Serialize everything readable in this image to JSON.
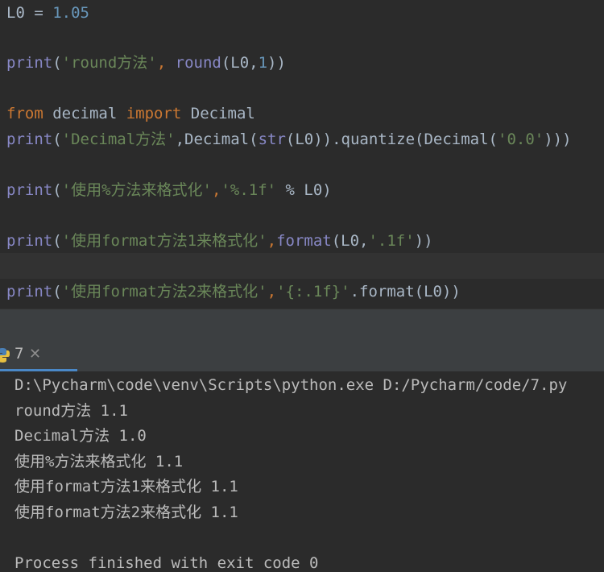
{
  "editor": {
    "line1": {
      "var": "L0",
      "eq": " = ",
      "num": "1.05"
    },
    "line2": {
      "fn": "print",
      "open": "(",
      "str": "'round方法'",
      "comma": ", ",
      "fn2": "round",
      "args_open": "(L0,",
      "num": "1",
      "close": "))"
    },
    "line3": {
      "kw1": "from",
      "mod": " decimal ",
      "kw2": "import",
      "name": " Decimal"
    },
    "line4": {
      "fn": "print",
      "open": "(",
      "str": "'Decimal方法'",
      "mid1": ",Decimal(",
      "fn2": "str",
      "mid2": "(L0)).quantize(Decimal(",
      "str2": "'0.0'",
      "close": ")))"
    },
    "line5": {
      "fn": "print",
      "open": "(",
      "str": "'使用%方法来格式化'",
      "comma": ",",
      "str2": "'%.1f'",
      "rest": " % L0)"
    },
    "line6": {
      "fn": "print",
      "open": "(",
      "str": "'使用format方法1来格式化'",
      "comma": ",",
      "fn2": "format",
      "mid": "(L0,",
      "str2": "'.1f'",
      "close": "))"
    },
    "line7": {
      "fn": "print",
      "open": "(",
      "str": "'使用format方法2来格式化'",
      "comma": ",",
      "str2": "'{:.1f}'",
      "rest": ".format(L0))"
    }
  },
  "run_panel": {
    "tab_label": "7",
    "close_glyph": "✕",
    "accent": "#4a88c7"
  },
  "console": {
    "lines": [
      "D:\\Pycharm\\code\\venv\\Scripts\\python.exe D:/Pycharm/code/7.py",
      "round方法 1.1",
      "Decimal方法 1.0",
      "使用%方法来格式化 1.1",
      "使用format方法1来格式化 1.1",
      "使用format方法2来格式化 1.1",
      "",
      "Process finished with exit code 0"
    ]
  }
}
